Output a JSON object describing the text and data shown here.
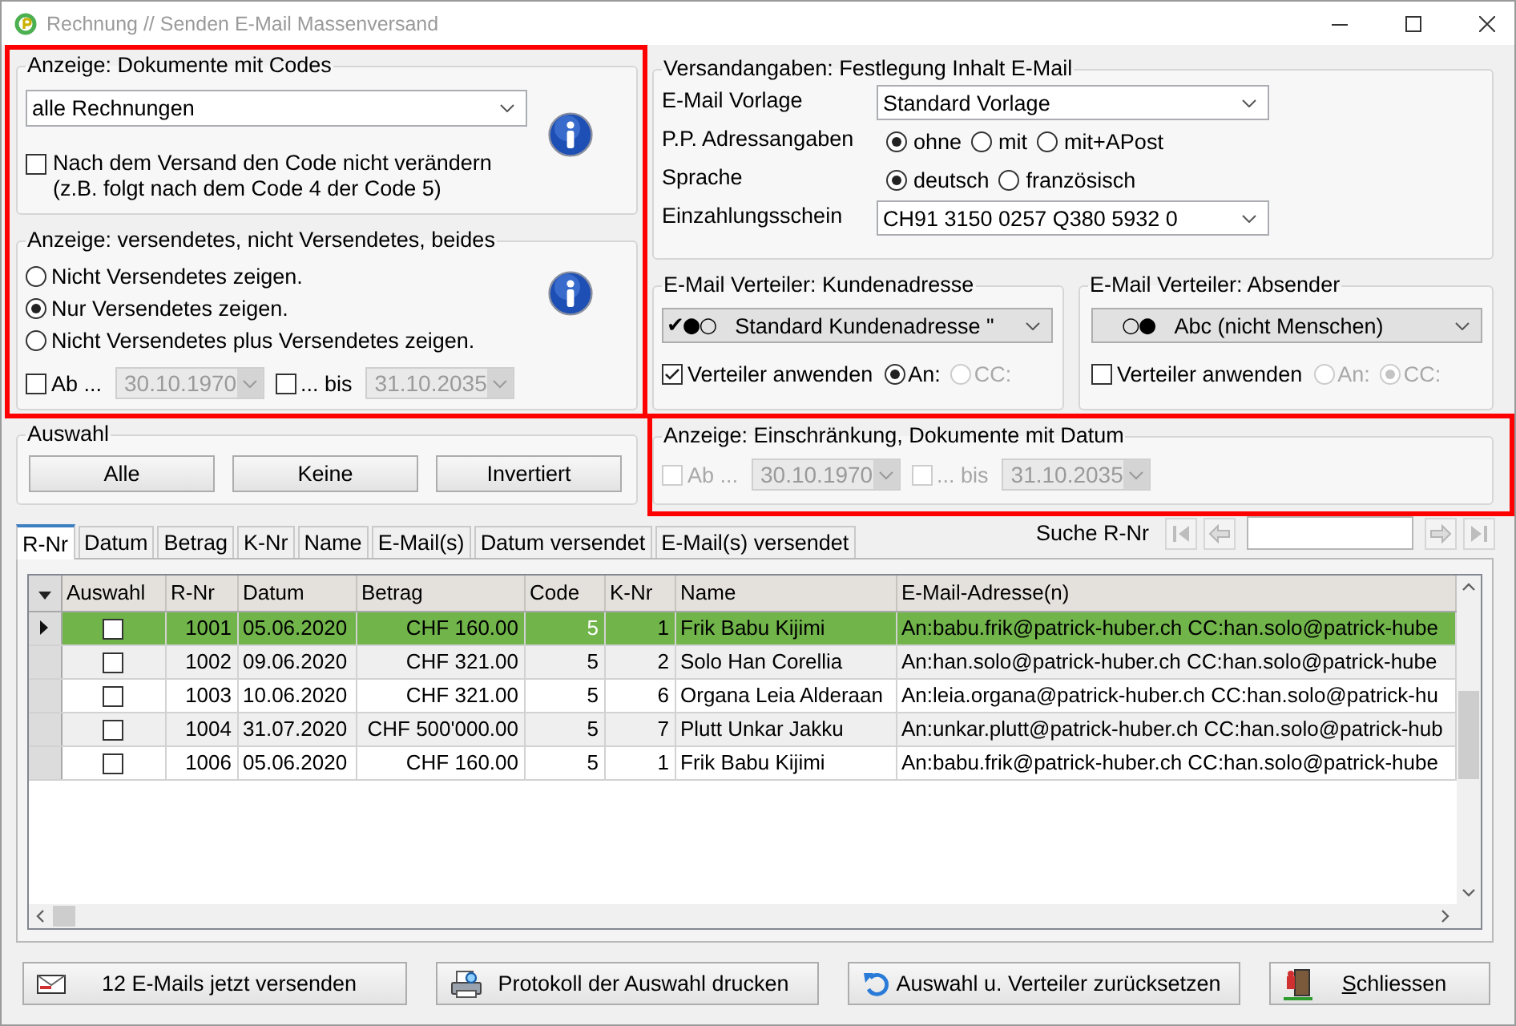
{
  "window": {
    "title": "Rechnung // Senden E-Mail Massenversand"
  },
  "display_filters": {
    "highlighted": true,
    "codes": {
      "title": "Anzeige: Dokumente mit Codes",
      "dropdown": {
        "value": "alle Rechnungen"
      },
      "keep_code": {
        "checked": false,
        "label": "Nach dem Versand den Code nicht verändern",
        "note": "(z.B. folgt nach dem Code 4 der Code 5)"
      }
    },
    "sent": {
      "title": "Anzeige: versendetes, nicht Versendetes, beides",
      "options": [
        {
          "label": "Nicht Versendetes zeigen.",
          "selected": false
        },
        {
          "label": "Nur Versendetes zeigen.",
          "selected": true
        },
        {
          "label": "Nicht Versendetes plus Versendetes zeigen.",
          "selected": false
        }
      ],
      "date_from": {
        "label": "Ab ...",
        "checked": false,
        "disabled": false,
        "value": "30.10.1970",
        "value_disabled": true
      },
      "date_to": {
        "label": "... bis",
        "checked": false,
        "disabled": false,
        "value": "31.10.2035",
        "value_disabled": true
      }
    }
  },
  "selection": {
    "title": "Auswahl",
    "buttons": [
      "Alle",
      "Keine",
      "Invertiert"
    ]
  },
  "shipping": {
    "title": "Versandangaben: Festlegung Inhalt E-Mail",
    "template": {
      "label": "E-Mail Vorlage",
      "value": "Standard Vorlage"
    },
    "address": {
      "label": "P.P. Adressangaben",
      "options": [
        {
          "label": "ohne",
          "selected": true
        },
        {
          "label": "mit",
          "selected": false
        },
        {
          "label": "mit+APost",
          "selected": false
        }
      ]
    },
    "language": {
      "label": "Sprache",
      "options": [
        {
          "label": "deutsch",
          "selected": true
        },
        {
          "label": "französisch",
          "selected": false
        }
      ]
    },
    "slip": {
      "label": "Einzahlungsschein",
      "value": "CH91 3150 0257 Q380 5932 0"
    }
  },
  "distributors": [
    {
      "title": "E-Mail Verteiler: Kundenadresse",
      "prefix": "✔●○",
      "value": "Standard Kundenadresse \"",
      "apply": {
        "label": "Verteiler anwenden",
        "checked": true
      },
      "recipients": [
        {
          "label": "An:",
          "selected": true,
          "disabled": false
        },
        {
          "label": "CC:",
          "selected": false,
          "disabled": true
        }
      ]
    },
    {
      "title": "E-Mail Verteiler: Absender",
      "prefix": "○●",
      "value": "Abc (nicht Menschen)",
      "apply": {
        "label": "Verteiler anwenden",
        "checked": false
      },
      "recipients": [
        {
          "label": "An:",
          "selected": false,
          "disabled": true
        },
        {
          "label": "CC:",
          "selected": true,
          "disabled": true
        }
      ]
    }
  ],
  "date_restriction": {
    "highlighted": true,
    "title": "Anzeige: Einschränkung, Dokumente mit Datum",
    "date_from": {
      "label": "Ab ...",
      "checked": false,
      "disabled": true,
      "value": "30.10.1970",
      "value_disabled": true
    },
    "date_to": {
      "label": "... bis",
      "checked": false,
      "disabled": true,
      "value": "31.10.2035",
      "value_disabled": true
    }
  },
  "tabs": [
    {
      "label": "R-Nr",
      "selected": true
    },
    {
      "label": "Datum",
      "selected": false
    },
    {
      "label": "Betrag",
      "selected": false
    },
    {
      "label": "K-Nr",
      "selected": false
    },
    {
      "label": "Name",
      "selected": false
    },
    {
      "label": "E-Mail(s)",
      "selected": false
    },
    {
      "label": "Datum versendet",
      "selected": false
    },
    {
      "label": "E-Mail(s) versendet",
      "selected": false
    }
  ],
  "search": {
    "label": "Suche R-Nr",
    "nav_disabled": true
  },
  "table": {
    "columns": [
      "Auswahl",
      "R-Nr",
      "Datum",
      "Betrag",
      "Code",
      "K-Nr",
      "Name",
      "E-Mail-Adresse(n)"
    ],
    "rows": [
      {
        "selected": true,
        "checked": false,
        "cells": [
          "",
          "1001",
          "05.06.2020",
          "CHF 160.00",
          "5",
          "1",
          "Frik Babu Kijimi",
          "An:babu.frik@patrick-huber.ch CC:han.solo@patrick-hube"
        ]
      },
      {
        "selected": false,
        "checked": false,
        "cells": [
          "",
          "1002",
          "09.06.2020",
          "CHF 321.00",
          "5",
          "2",
          "Solo Han Corellia",
          "An:han.solo@patrick-huber.ch CC:han.solo@patrick-hube"
        ]
      },
      {
        "selected": false,
        "checked": false,
        "cells": [
          "",
          "1003",
          "10.06.2020",
          "CHF 321.00",
          "5",
          "6",
          "Organa Leia Alderaan",
          "An:leia.organa@patrick-huber.ch CC:han.solo@patrick-hu"
        ]
      },
      {
        "selected": false,
        "checked": false,
        "cells": [
          "",
          "1004",
          "31.07.2020",
          "CHF 500'000.00",
          "5",
          "7",
          "Plutt Unkar Jakku",
          "An:unkar.plutt@patrick-huber.ch CC:han.solo@patrick-hub"
        ]
      },
      {
        "selected": false,
        "checked": false,
        "cells": [
          "",
          "1006",
          "05.06.2020",
          "CHF 160.00",
          "5",
          "1",
          "Frik Babu Kijimi",
          "An:babu.frik@patrick-huber.ch CC:han.solo@patrick-hube"
        ]
      }
    ]
  },
  "actions": [
    {
      "kind": "send",
      "label": "12 E-Mails jetzt versenden",
      "mnemonic_underlined": false
    },
    {
      "kind": "print",
      "label": "Protokoll der Auswahl drucken",
      "mnemonic_underlined": false
    },
    {
      "kind": "reset",
      "label": "Auswahl u. Verteiler zurücksetzen",
      "mnemonic_underlined": false
    },
    {
      "kind": "close",
      "label": "Schliessen",
      "mnemonic_underlined": true
    }
  ]
}
